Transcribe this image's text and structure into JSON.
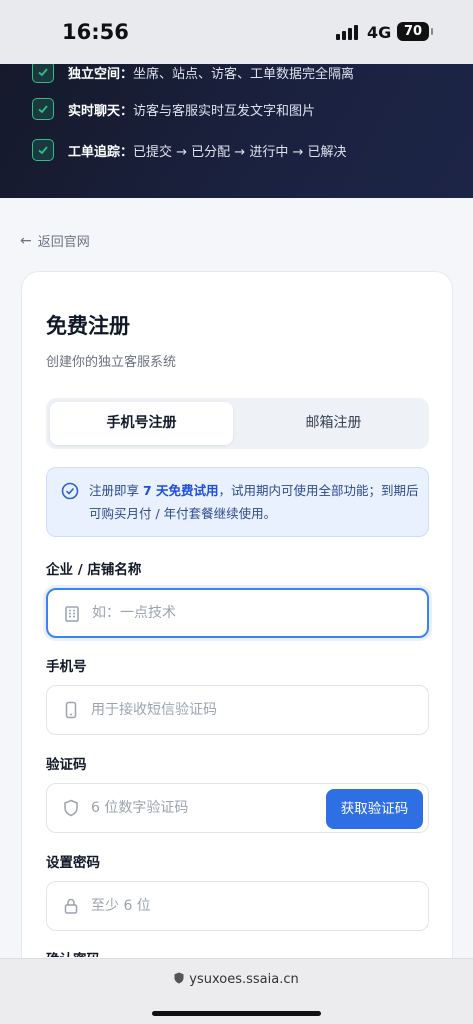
{
  "status_bar": {
    "time": "16:56",
    "network": "4G",
    "battery": "70"
  },
  "hero": {
    "features": [
      {
        "title": "独立空间：",
        "desc": "坐席、站点、访客、工单数据完全隔离"
      },
      {
        "title": "实时聊天：",
        "desc": "访客与客服实时互发文字和图片"
      },
      {
        "title": "工单追踪：",
        "desc": "已提交 → 已分配 → 进行中 → 已解决"
      }
    ]
  },
  "back_link": {
    "label": "返回官网"
  },
  "card": {
    "title": "免费注册",
    "subtitle": "创建你的独立客服系统",
    "tabs": [
      {
        "label": "手机号注册",
        "active": true
      },
      {
        "label": "邮箱注册",
        "active": false
      }
    ],
    "notice": {
      "prefix": "注册即享 ",
      "highlight": "7 天免费试用",
      "suffix": "，试用期内可使用全部功能；到期后可购买月付 / 年付套餐继续使用。"
    },
    "fields": {
      "company": {
        "label": "企业 / 店铺名称",
        "placeholder": "如：一点技术",
        "value": ""
      },
      "phone": {
        "label": "手机号",
        "placeholder": "用于接收短信验证码",
        "value": ""
      },
      "code": {
        "label": "验证码",
        "placeholder": "6 位数字验证码",
        "value": "",
        "button": "获取验证码"
      },
      "password": {
        "label": "设置密码",
        "placeholder": "至少 6 位",
        "value": ""
      },
      "confirm": {
        "label": "确认密码"
      }
    }
  },
  "browser": {
    "url": "ysuxoes.ssaia.cn"
  },
  "colors": {
    "accent": "#2f6fe4",
    "success": "#2fbf87",
    "hero_bg": "#1b2240"
  }
}
